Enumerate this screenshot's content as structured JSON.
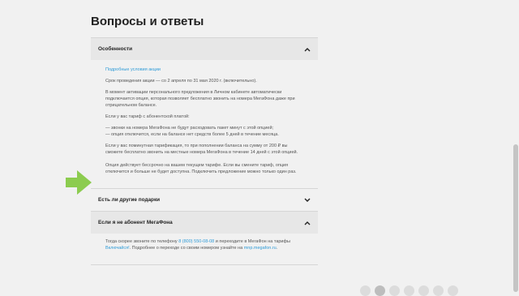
{
  "page": {
    "title": "Вопросы и ответы"
  },
  "faq": {
    "item1": {
      "question": "Особенности",
      "link": "Подробные условия акции",
      "p1": "Срок проведения акции — со 2 апреля по 31 мая 2020 г. (включительно).",
      "p2": "В момент активации персонального предложения в Личном кабинете автоматически подключается опция, которая позволяет бесплатно звонить на номера МегаФона даже при отрицательном балансе.",
      "p3": "Если у вас тариф с абонентской платой:",
      "p4a": "— звонки на номера МегаФона не будут расходовать пакет минут с этой опцией;",
      "p4b": "— опция отключится, если на балансе нет средств более 5 дней в течение месяца.",
      "p5": "Если у вас поминутная тарификация, то при пополнении баланса на сумму от 200 ₽ вы сможете бесплатно звонить на местные номера МегаФона в течение 14 дней с этой опцией.",
      "p6": "Опция действует бессрочно на вашем текущем тарифе. Если вы смените тариф, опция отключится и больше не будет доступна. Подключить предложение можно только один раз."
    },
    "item2": {
      "question": "Есть ли другие подарки"
    },
    "item3": {
      "question": "Если я не абонент МегаФона",
      "t1": "Тогда скорее звоните по телефону ",
      "phone": "8 (800) 550-08-08",
      "t2": " и переходите в МегаФон на тарифы ",
      "tariffs": "Включайся!",
      "t3": ". Подробнее о переходе со своим номером узнайте на ",
      "site": "mnp.megafon.ru",
      "t4": "."
    }
  },
  "colors": {
    "arrow": "#8ccc4f",
    "link": "#2f9bd7"
  }
}
